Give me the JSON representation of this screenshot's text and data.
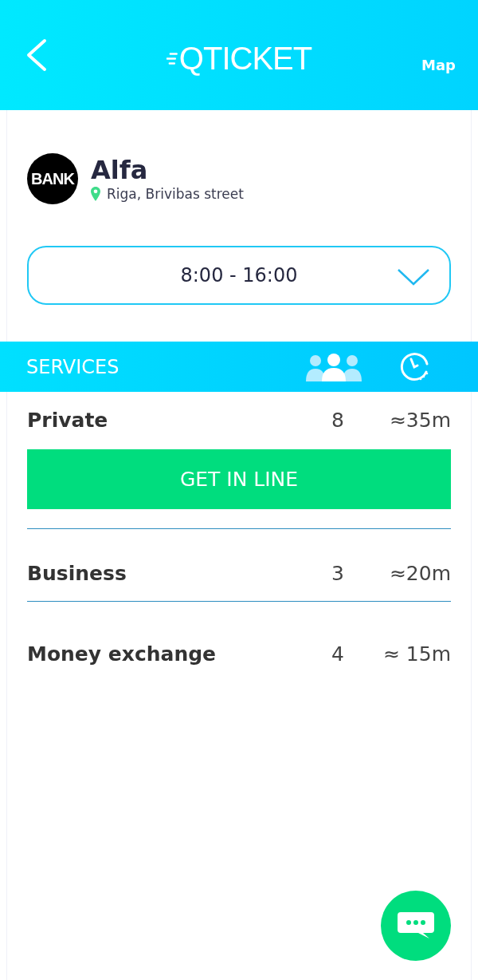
{
  "header": {
    "logo": "QTICKET",
    "map_link": "Map"
  },
  "branch": {
    "badge": "BANK",
    "name": "Alfa",
    "address": "Riga, Brivibas street"
  },
  "hours": {
    "value": "8:00 - 16:00"
  },
  "services_header": {
    "title": "SERVICES"
  },
  "services": [
    {
      "name": "Private",
      "queue": "8",
      "wait": "≈35m",
      "button": "GET IN LINE"
    },
    {
      "name": "Business",
      "queue": "3",
      "wait": "≈20m"
    },
    {
      "name": "Money exchange",
      "queue": "4",
      "wait": "≈ 15m"
    }
  ]
}
